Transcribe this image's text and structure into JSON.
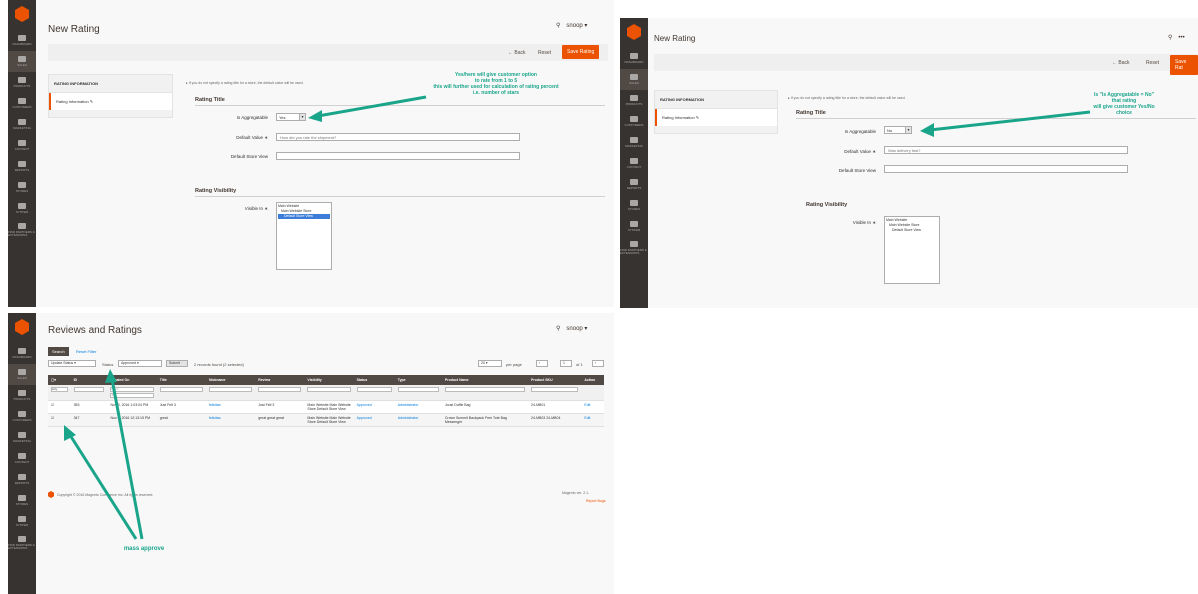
{
  "nav_items": [
    {
      "label": "DASHBOARD",
      "icon": "dashboard-icon"
    },
    {
      "label": "SALES",
      "icon": "dollar-icon"
    },
    {
      "label": "PRODUCTS",
      "icon": "cube-icon"
    },
    {
      "label": "CUSTOMERS",
      "icon": "user-icon"
    },
    {
      "label": "MARKETING",
      "icon": "megaphone-icon"
    },
    {
      "label": "CONTENT",
      "icon": "layout-icon"
    },
    {
      "label": "REPORTS",
      "icon": "bar-chart-icon"
    },
    {
      "label": "STORES",
      "icon": "store-icon"
    },
    {
      "label": "SYSTEM",
      "icon": "gear-icon"
    },
    {
      "label": "FIND PARTNERS & EXTENSIONS",
      "icon": "puzzle-icon"
    }
  ],
  "panel_a": {
    "title": "New Rating",
    "user": "snoop ▾",
    "back": "← Back",
    "reset": "Reset",
    "save": "Save Rating",
    "nav_head": "RATING INFORMATION",
    "nav_item": "Rating Information ✎",
    "note": "▸ If you do not specify a rating title for a store, the default value will be used.",
    "section1": "Rating Title",
    "is_agg_label": "Is Aggregatable",
    "is_agg_value": "Yes",
    "default_label": "Default Value ∗",
    "default_value": "How did you rate the shipment?",
    "default_store_label": "Default Store View",
    "default_store_value": "",
    "section2": "Rating Visibility",
    "visible_label": "Visible In ∗",
    "visible_options": [
      "Main Website",
      "Main Website Store",
      "Default Store View"
    ],
    "annotation": [
      "Yes/here will give customer option",
      "to rate from 1 to 5",
      "this will further used for calculation of rating percent",
      "i.e. number of stars"
    ]
  },
  "panel_b": {
    "title": "New Rating",
    "user": "•••",
    "back": "← Back",
    "reset": "Reset",
    "save": "Save Rat",
    "nav_head": "RATING INFORMATION",
    "nav_item": "Rating Information ✎",
    "note": "▸ If you do not specify a rating title for a store, the default value will be used.",
    "section1": "Rating Title",
    "is_agg_label": "Is Aggregatable",
    "is_agg_value": "No",
    "default_label": "Default Value ∗",
    "default_value": "Was delivery fast?",
    "default_store_label": "Default Store View",
    "default_store_value": "",
    "section2": "Rating Visibility",
    "visible_label": "Visible In ∗",
    "visible_options": [
      "Main Website",
      "Main Website Store",
      "Default Store View"
    ],
    "annotation": [
      "Is \"Is Aggregatable = No\"",
      "that rating",
      "will give customer Yes/No",
      "choice"
    ]
  },
  "panel_c": {
    "title": "Reviews and Ratings",
    "user": "snoop ▾",
    "search_btn": "Search",
    "reset_filter": "Reset Filter",
    "mass_action": "Update Status",
    "status_label": "Status",
    "status_value": "Approved",
    "submit": "Submit",
    "records": "2 records found (2 selected)",
    "per_page_value": "20",
    "per_page_label": "per page",
    "page": "1",
    "of_pages": "of 1",
    "columns": [
      "",
      "ID",
      "Created On",
      "Title",
      "Nickname",
      "Review",
      "Visibility",
      "Status",
      "Type",
      "Product Name",
      "Product SKU",
      "Action"
    ],
    "filter_any": "Any",
    "filter_from": "From",
    "filter_to": "To",
    "rows": [
      {
        "id": "353",
        "created": "Nov 3, 2016 1:03:04 PM",
        "title": "Just Felt 3",
        "nickname": "felicitas",
        "review": "Just Felt 3",
        "visibility": "Main Website Main Website Store Default Store View",
        "status": "Approved",
        "type": "Administrator",
        "product": "Joust Duffle Bag",
        "sku": "24-MB01",
        "action": "Edit"
      },
      {
        "id": "347",
        "created": "Nov 3, 2016 12:13:15 PM",
        "title": "great",
        "nickname": "felicitas",
        "review": "great great great",
        "visibility": "Main Website Main Website Store Default Store View",
        "status": "Approved",
        "type": "Administrator",
        "product": "Crown Summit Backpack Free Tote Bag Messenger",
        "sku": "24-MB03 24-MB04",
        "action": "Edit"
      }
    ],
    "copyright": "Copyright © 2016 Magento Commerce Inc. All rights reserved.",
    "version": "Magento ver. 2.1.",
    "report_bugs": "Report Bugs",
    "annotation": "mass approve"
  },
  "accent": "#eb5202",
  "annotation_color": "#1aa58b",
  "sidebar_color": "#373330"
}
